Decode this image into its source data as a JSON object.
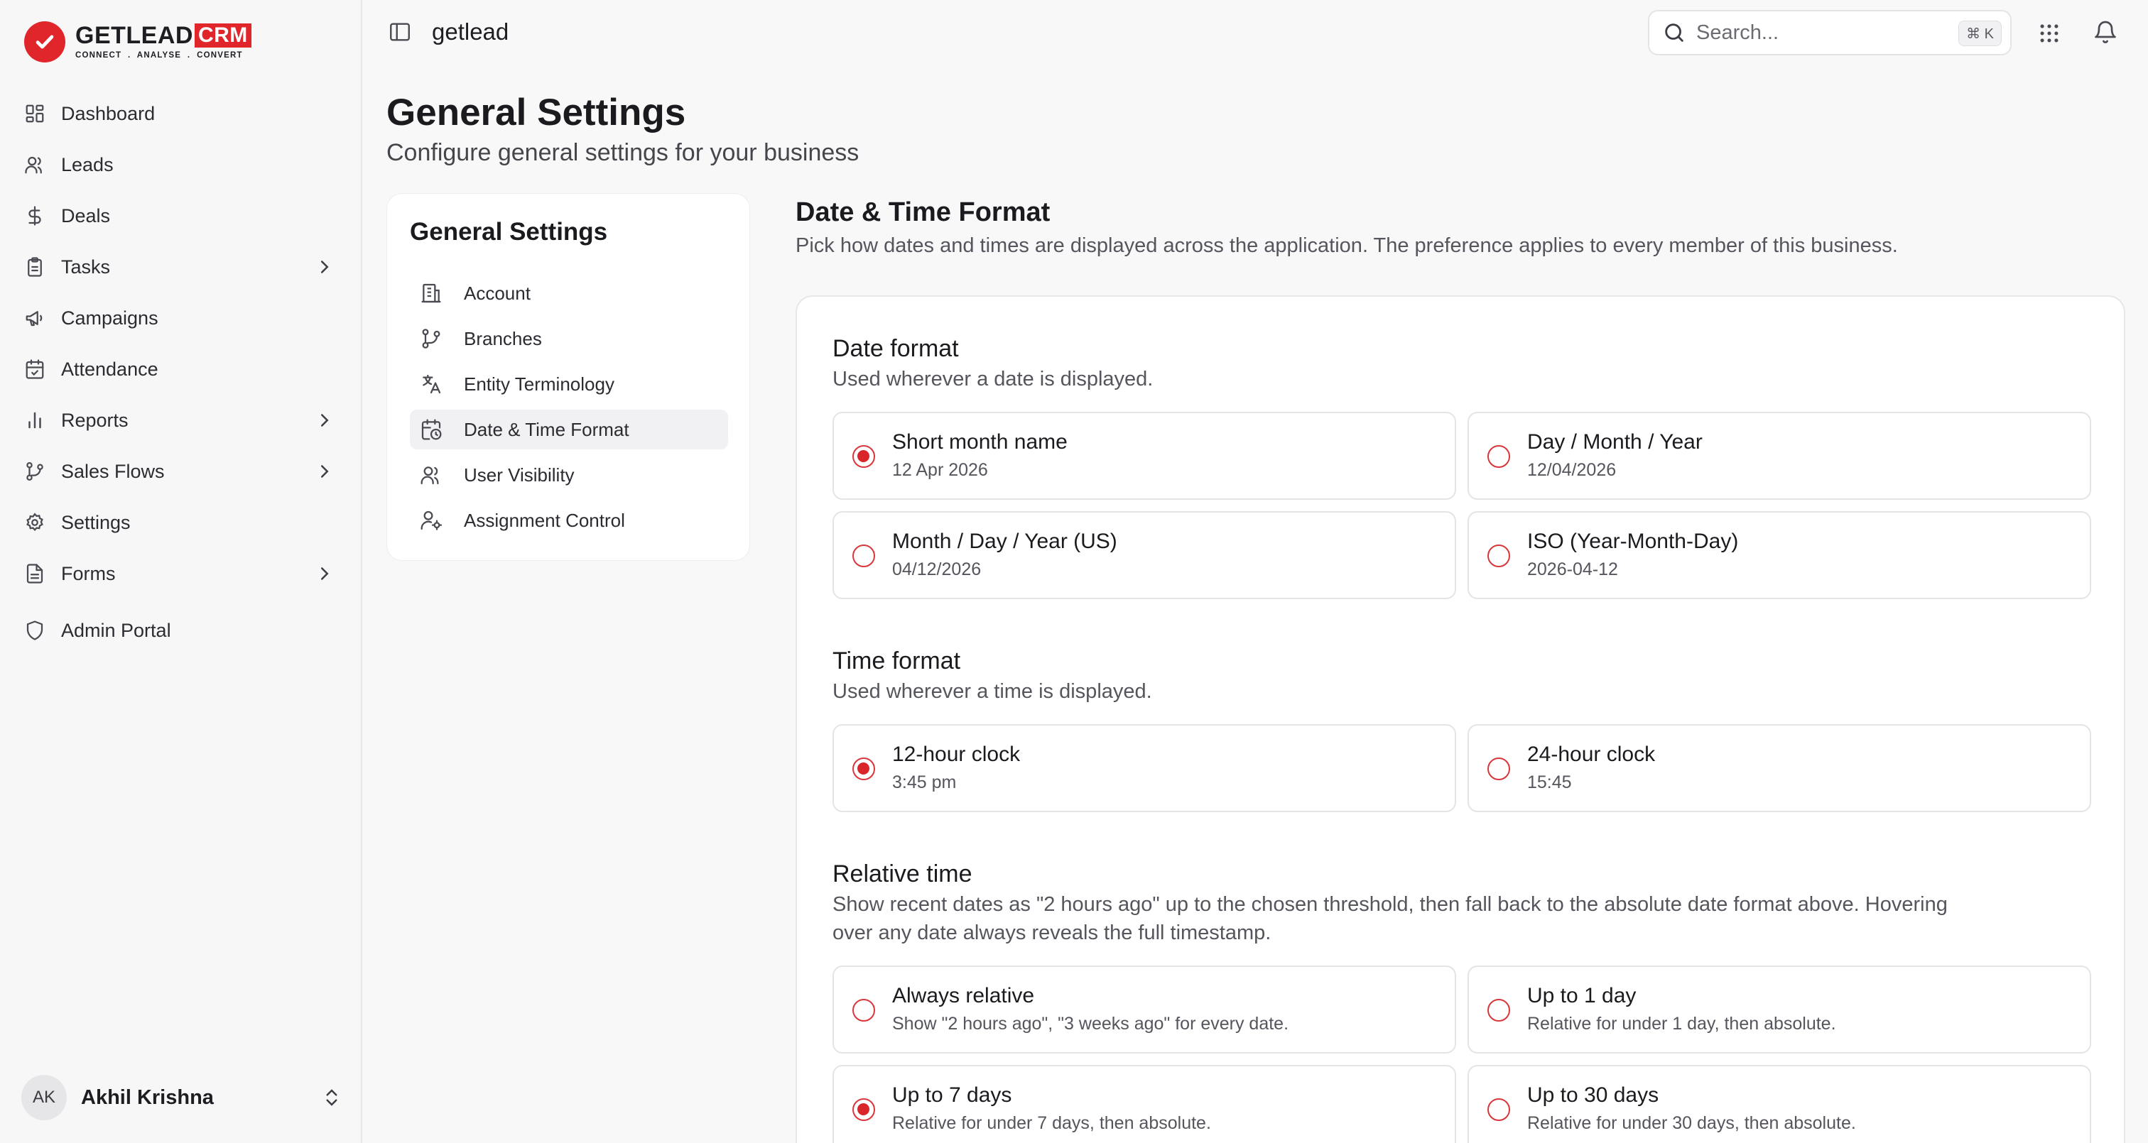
{
  "brand": {
    "name": "GETLEAD",
    "badge": "CRM",
    "tagline": "CONNECT  .  ANALYSE  .  CONVERT",
    "accent": "#e0262b"
  },
  "sidebar": {
    "items": [
      {
        "label": "Dashboard",
        "icon": "dashboard-icon",
        "chevron": false
      },
      {
        "label": "Leads",
        "icon": "users-icon",
        "chevron": false
      },
      {
        "label": "Deals",
        "icon": "dollar-icon",
        "chevron": false
      },
      {
        "label": "Tasks",
        "icon": "clipboard-icon",
        "chevron": true
      },
      {
        "label": "Campaigns",
        "icon": "megaphone-icon",
        "chevron": false
      },
      {
        "label": "Attendance",
        "icon": "calendar-check-icon",
        "chevron": false
      },
      {
        "label": "Reports",
        "icon": "bar-chart-icon",
        "chevron": true
      },
      {
        "label": "Sales Flows",
        "icon": "git-branch-icon",
        "chevron": true
      },
      {
        "label": "Settings",
        "icon": "gear-icon",
        "chevron": false
      },
      {
        "label": "Forms",
        "icon": "file-text-icon",
        "chevron": true
      },
      {
        "label": "Admin Portal",
        "icon": "shield-icon",
        "chevron": false
      }
    ],
    "user": {
      "initials": "AK",
      "name": "Akhil Krishna"
    }
  },
  "topbar": {
    "workspace": "getlead",
    "search_placeholder": "Search...",
    "search_shortcut": "⌘ K"
  },
  "page": {
    "title": "General Settings",
    "subtitle": "Configure general settings for your business"
  },
  "settings_nav": {
    "title": "General Settings",
    "items": [
      {
        "label": "Account",
        "icon": "building-icon",
        "active": false
      },
      {
        "label": "Branches",
        "icon": "git-branch-icon",
        "active": false
      },
      {
        "label": "Entity Terminology",
        "icon": "translate-icon",
        "active": false
      },
      {
        "label": "Date & Time Format",
        "icon": "calendar-clock-icon",
        "active": true
      },
      {
        "label": "User Visibility",
        "icon": "users-icon",
        "active": false
      },
      {
        "label": "Assignment Control",
        "icon": "user-cog-icon",
        "active": false
      }
    ]
  },
  "content": {
    "title": "Date & Time Format",
    "description": "Pick how dates and times are displayed across the application. The preference applies to every member of this business.",
    "date_format": {
      "title": "Date format",
      "description": "Used wherever a date is displayed.",
      "options": [
        {
          "label": "Short month name",
          "example": "12 Apr 2026",
          "selected": true
        },
        {
          "label": "Day / Month / Year",
          "example": "12/04/2026",
          "selected": false
        },
        {
          "label": "Month / Day / Year (US)",
          "example": "04/12/2026",
          "selected": false
        },
        {
          "label": "ISO (Year-Month-Day)",
          "example": "2026-04-12",
          "selected": false
        }
      ]
    },
    "time_format": {
      "title": "Time format",
      "description": "Used wherever a time is displayed.",
      "options": [
        {
          "label": "12-hour clock",
          "example": "3:45 pm",
          "selected": true
        },
        {
          "label": "24-hour clock",
          "example": "15:45",
          "selected": false
        }
      ]
    },
    "relative_time": {
      "title": "Relative time",
      "description_line1": "Show recent dates as \"2 hours ago\" up to the chosen threshold, then fall back to the absolute date format above. Hovering",
      "description_line2": "over any date always reveals the full timestamp.",
      "options": [
        {
          "label": "Always relative",
          "example": "Show \"2 hours ago\", \"3 weeks ago\" for every date.",
          "selected": false
        },
        {
          "label": "Up to 1 day",
          "example": "Relative for under 1 day, then absolute.",
          "selected": false
        },
        {
          "label": "Up to 7 days",
          "example": "Relative for under 7 days, then absolute.",
          "selected": true
        },
        {
          "label": "Up to 30 days",
          "example": "Relative for under 30 days, then absolute.",
          "selected": false
        }
      ]
    }
  }
}
